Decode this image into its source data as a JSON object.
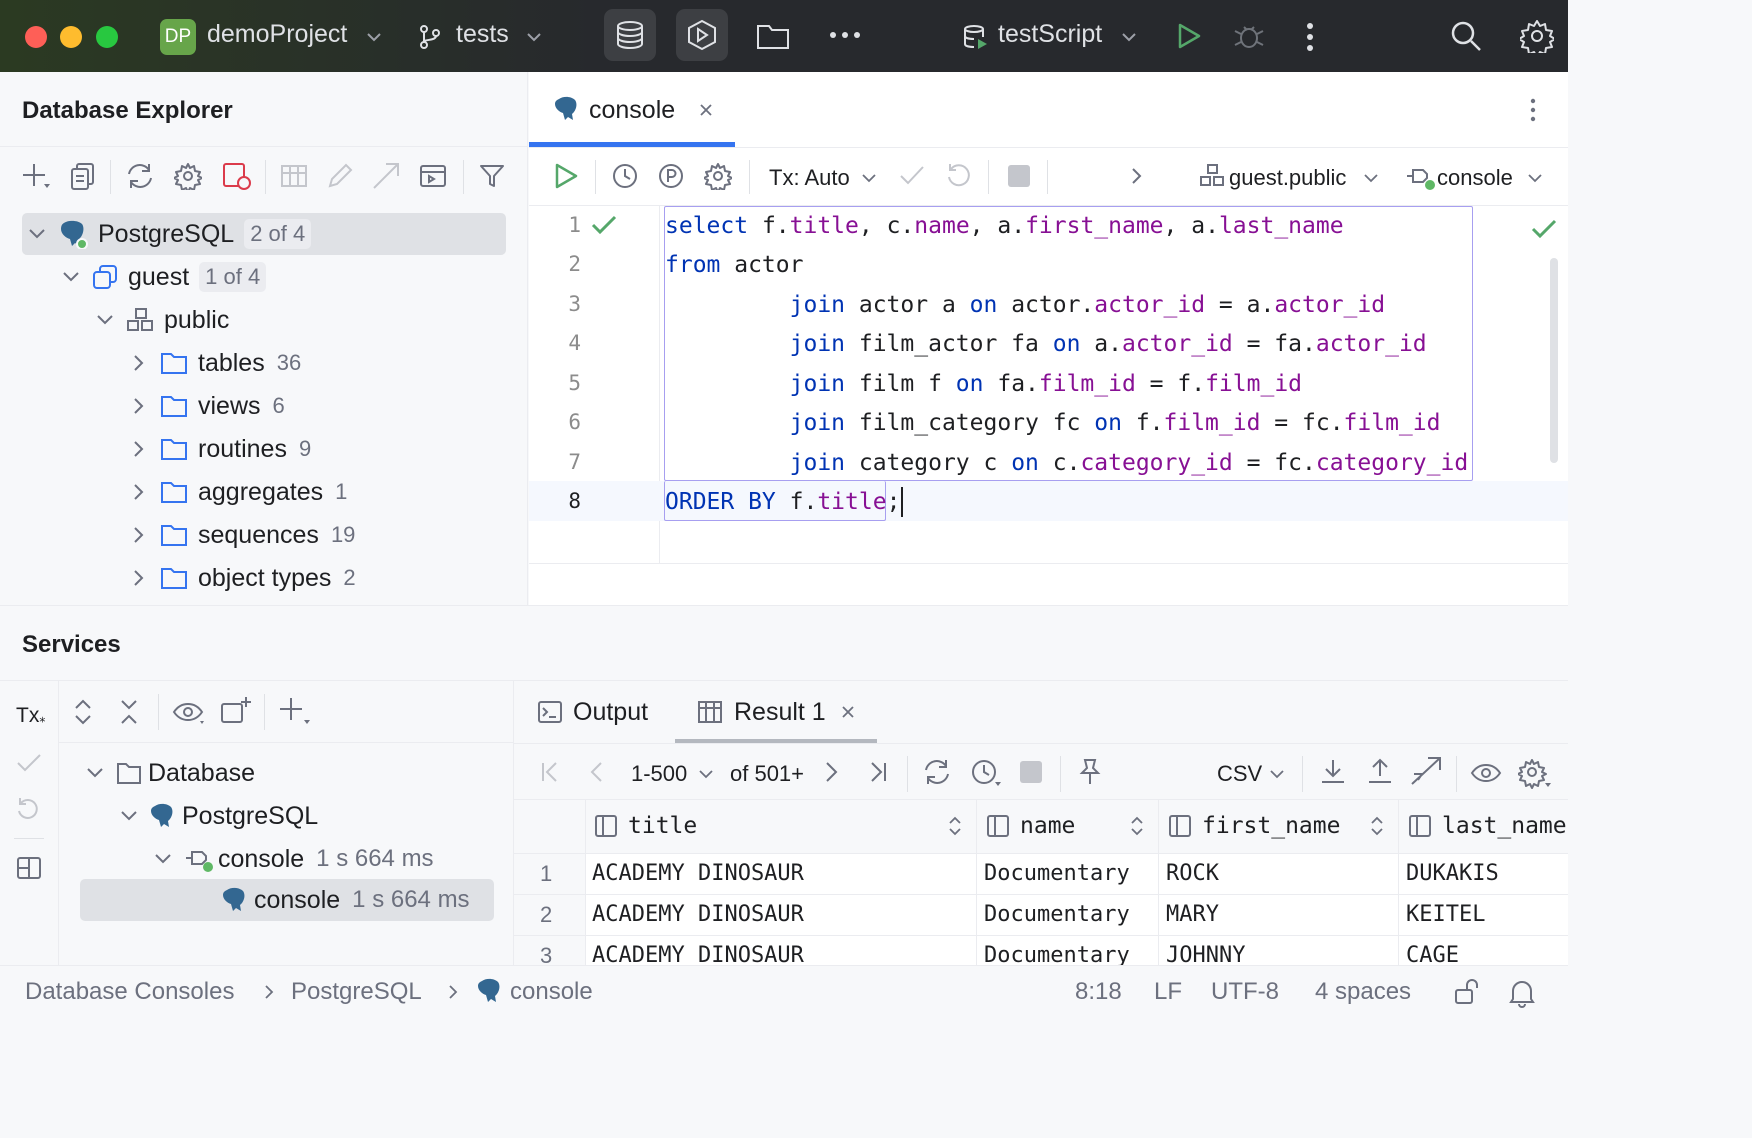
{
  "titlebar": {
    "project_badge": "DP",
    "project": "demoProject",
    "branch": "tests",
    "run_config": "testScript"
  },
  "explorer": {
    "title": "Database Explorer",
    "tree": {
      "root": {
        "label": "PostgreSQL",
        "badge": "2 of 4"
      },
      "guest": {
        "label": "guest",
        "badge": "1 of 4"
      },
      "public": {
        "label": "public"
      },
      "folders": [
        {
          "label": "tables",
          "count": "36"
        },
        {
          "label": "views",
          "count": "6"
        },
        {
          "label": "routines",
          "count": "9"
        },
        {
          "label": "aggregates",
          "count": "1"
        },
        {
          "label": "sequences",
          "count": "19"
        },
        {
          "label": "object types",
          "count": "2"
        }
      ]
    }
  },
  "editor": {
    "tab": "console",
    "tx_mode": "Tx: Auto",
    "schema": "guest.public",
    "session": "console",
    "line_numbers": [
      "1",
      "2",
      "3",
      "4",
      "5",
      "6",
      "7",
      "8"
    ]
  },
  "services": {
    "title": "Services",
    "tx_label": "Tx",
    "tree": {
      "database": "Database",
      "postgres": "PostgreSQL",
      "console": {
        "label": "console",
        "time": "1 s 664 ms"
      },
      "console_child": {
        "label": "console",
        "time": "1 s 664 ms"
      }
    },
    "tabs": {
      "output": "Output",
      "result": "Result 1"
    },
    "pager": {
      "range": "1-500",
      "total": "of 501+"
    },
    "export_format": "CSV",
    "columns": [
      "title",
      "name",
      "first_name",
      "last_name"
    ],
    "row_numbers": [
      "1",
      "2",
      "3"
    ],
    "rows": [
      [
        "ACADEMY DINOSAUR",
        "Documentary",
        "ROCK",
        "DUKAKIS"
      ],
      [
        "ACADEMY DINOSAUR",
        "Documentary",
        "MARY",
        "KEITEL"
      ],
      [
        "ACADEMY DINOSAUR",
        "Documentary",
        "JOHNNY",
        "CAGE"
      ]
    ]
  },
  "statusbar": {
    "crumbs": [
      "Database Consoles",
      "PostgreSQL",
      "console"
    ],
    "position": "8:18",
    "line_sep": "LF",
    "encoding": "UTF-8",
    "indent": "4 spaces"
  },
  "colors": {
    "accent": "#3574f0",
    "keyword": "#0033b3",
    "field": "#871094",
    "run_green": "#55a76a"
  }
}
